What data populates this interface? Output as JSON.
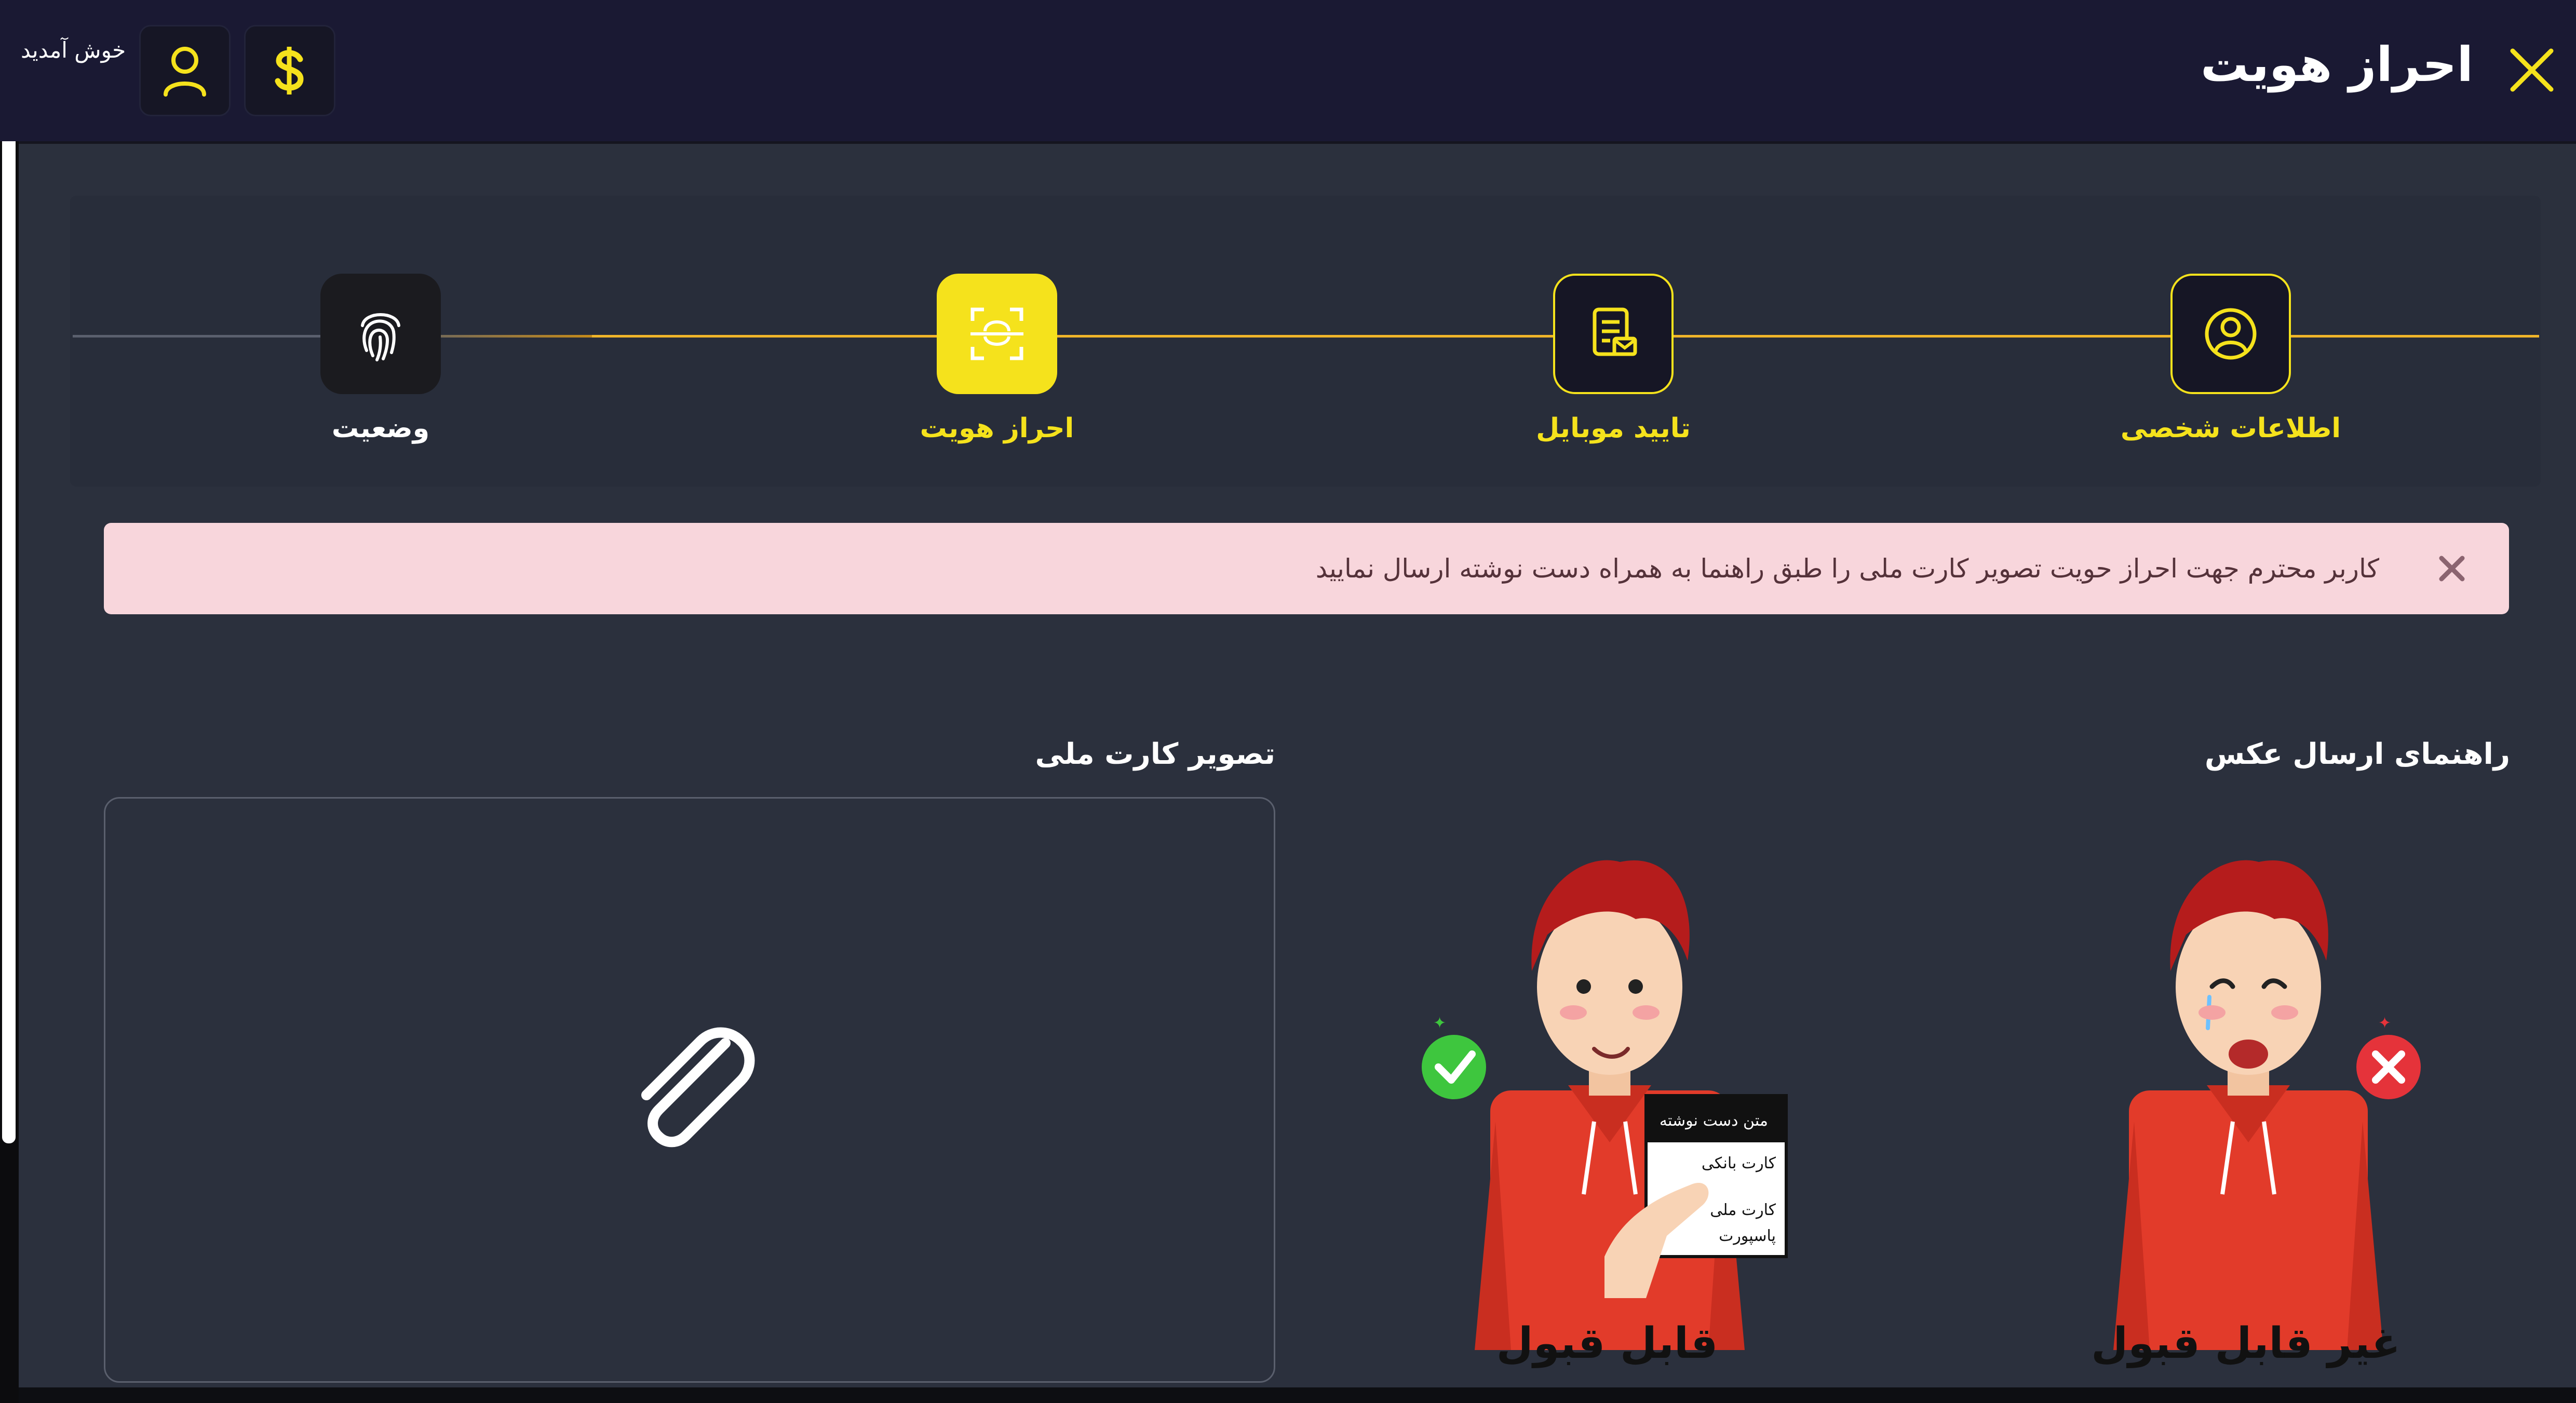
{
  "header": {
    "title": "احراز هویت",
    "welcome": "خوش آمدید",
    "icons": [
      "close-icon",
      "user-icon",
      "dollar-icon"
    ],
    "accent_color": "#f5e21c"
  },
  "steps": [
    {
      "label": "اطلاعات شخصی",
      "icon": "user-circle-icon",
      "state": "done"
    },
    {
      "label": "تایید موبایل",
      "icon": "mobile-verify-icon",
      "state": "done"
    },
    {
      "label": "احراز هویت",
      "icon": "face-scan-icon",
      "state": "active"
    },
    {
      "label": "وضعیت",
      "icon": "fingerprint-icon",
      "state": "pending"
    }
  ],
  "alert": {
    "text": "کاربر محترم جهت احراز حویت تصویر کارت ملی را طبق راهنما به همراه دست نوشته ارسال نمایید",
    "background": "#f8d6dc"
  },
  "guide": {
    "title": "راهنمای ارسال عکس",
    "acceptable_label": "قابل قبول",
    "unacceptable_label": "غیر قابل قبول",
    "card_lines": [
      "متن دست نوشته",
      "کارت بانکی",
      "کارت ملی",
      "پاسپورت"
    ]
  },
  "upload": {
    "title": "تصویر کارت ملی",
    "icon": "paperclip-icon"
  }
}
